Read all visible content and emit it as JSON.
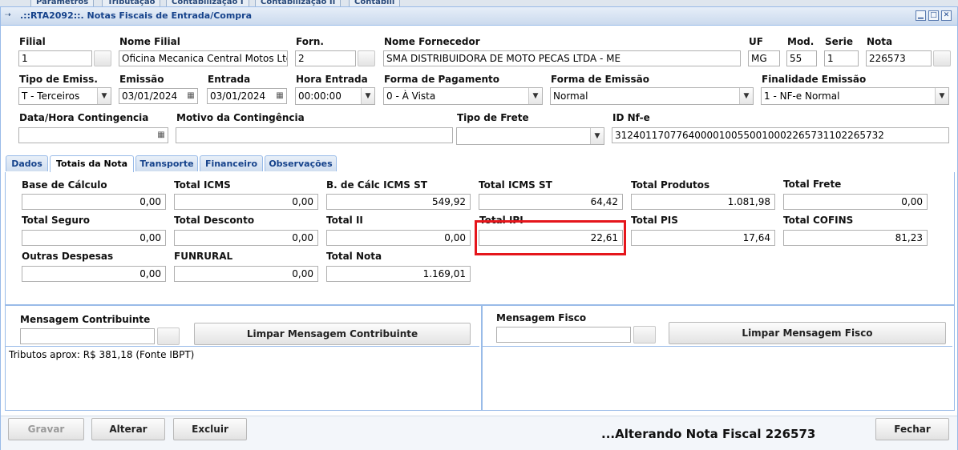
{
  "background_tabs": [
    "Parâmetros",
    "Tributação",
    "Contabilização I",
    "Contabilização II",
    "Contabili"
  ],
  "window": {
    "title": ".::RTA2092::. Notas Fiscais de Entrada/Compra",
    "icon": "window-app-icon",
    "min_icon": "minimize-icon",
    "max_icon": "maximize-icon",
    "close_icon": "close-icon"
  },
  "header": {
    "filial": {
      "label": "Filial",
      "value": "1"
    },
    "nome_filial": {
      "label": "Nome Filial",
      "value": "Oficina Mecanica Central Motos Ltd"
    },
    "forn": {
      "label": "Forn.",
      "value": "2"
    },
    "nome_fornecedor": {
      "label": "Nome Fornecedor",
      "value": "SMA DISTRIBUIDORA DE MOTO PECAS LTDA - ME"
    },
    "uf": {
      "label": "UF",
      "value": "MG"
    },
    "mod": {
      "label": "Mod.",
      "value": "55"
    },
    "serie": {
      "label": "Serie",
      "value": "1"
    },
    "nota": {
      "label": "Nota",
      "value": "226573"
    },
    "tipo_emiss": {
      "label": "Tipo de Emiss.",
      "value": "T - Terceiros"
    },
    "emissao": {
      "label": "Emissão",
      "value": "03/01/2024"
    },
    "entrada": {
      "label": "Entrada",
      "value": "03/01/2024"
    },
    "hora_entrada": {
      "label": "Hora Entrada",
      "value": "00:00:00"
    },
    "forma_pagamento": {
      "label": "Forma de Pagamento",
      "value": "0 - À Vista"
    },
    "forma_emissao": {
      "label": "Forma de Emissão",
      "value": "Normal"
    },
    "finalidade": {
      "label": "Finalidade Emissão",
      "value": "1 - NF-e Normal"
    },
    "data_contingencia": {
      "label": "Data/Hora Contingencia",
      "value": ""
    },
    "motivo_contingencia": {
      "label": "Motivo da Contingência",
      "value": ""
    },
    "tipo_frete": {
      "label": "Tipo de Frete",
      "value": ""
    },
    "id_nfe": {
      "label": "ID Nf-e",
      "value": "31240117077640000100550010002265731102265732"
    }
  },
  "tabs": [
    {
      "label": "Dados",
      "active": false
    },
    {
      "label": "Totais da Nota",
      "active": true
    },
    {
      "label": "Transporte",
      "active": false
    },
    {
      "label": "Financeiro",
      "active": false
    },
    {
      "label": "Observações",
      "active": false
    }
  ],
  "totais": {
    "base_calculo": {
      "label": "Base de Cálculo",
      "value": "0,00"
    },
    "total_icms": {
      "label": "Total ICMS",
      "value": "0,00"
    },
    "bc_icms_st": {
      "label": "B. de Cálc ICMS ST",
      "value": "549,92"
    },
    "total_icms_st": {
      "label": "Total ICMS ST",
      "value": "64,42"
    },
    "total_produtos": {
      "label": "Total Produtos",
      "value": "1.081,98"
    },
    "total_frete": {
      "label": "Total Frete",
      "value": "0,00"
    },
    "total_seguro": {
      "label": "Total Seguro",
      "value": "0,00"
    },
    "total_desconto": {
      "label": "Total Desconto",
      "value": "0,00"
    },
    "total_ii": {
      "label": "Total II",
      "value": "0,00"
    },
    "total_ipi": {
      "label": "Total IPI",
      "value": "22,61"
    },
    "total_pis": {
      "label": "Total PIS",
      "value": "17,64"
    },
    "total_cofins": {
      "label": "Total COFINS",
      "value": "81,23"
    },
    "outras_despesas": {
      "label": "Outras Despesas",
      "value": "0,00"
    },
    "funrural": {
      "label": "FUNRURAL",
      "value": "0,00"
    },
    "total_nota": {
      "label": "Total Nota",
      "value": "1.169,01"
    }
  },
  "mensagens": {
    "contribuinte": {
      "label": "Mensagem Contribuinte",
      "value": "",
      "clear_button": "Limpar Mensagem Contribuinte",
      "text": "Tributos aprox: R$ 381,18 (Fonte IBPT)"
    },
    "fisco": {
      "label": "Mensagem Fisco",
      "value": "",
      "clear_button": "Limpar Mensagem Fisco",
      "text": ""
    }
  },
  "actions": {
    "gravar": "Gravar",
    "alterar": "Alterar",
    "excluir": "Excluir",
    "fechar": "Fechar"
  },
  "status_text": "...Alterando Nota Fiscal 226573",
  "colors": {
    "accent": "#15428b",
    "border": "#99bbe8",
    "highlight": "#e5161c"
  }
}
